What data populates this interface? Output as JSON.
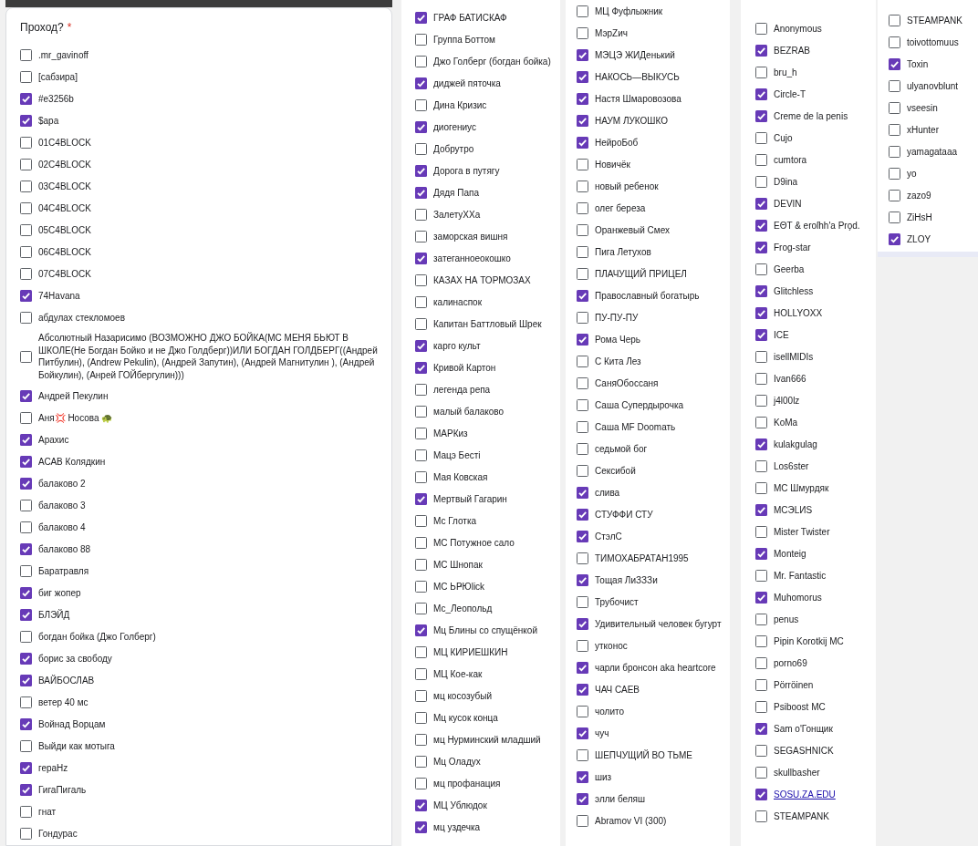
{
  "columns": [
    {
      "question": "Проход?",
      "required_mark": "*",
      "options": [
        {
          "label": ".mr_gavinoff",
          "checked": false
        },
        {
          "label": "[сабзира]",
          "checked": false
        },
        {
          "label": "#e3256b",
          "checked": true
        },
        {
          "label": "$apa",
          "checked": true
        },
        {
          "label": "01C4BLOCK",
          "checked": false
        },
        {
          "label": "02C4BLOCK",
          "checked": false
        },
        {
          "label": "03C4BLOCK",
          "checked": false
        },
        {
          "label": "04C4BLOCK",
          "checked": false
        },
        {
          "label": "05C4BLOCK",
          "checked": false
        },
        {
          "label": "06C4BLOCK",
          "checked": false
        },
        {
          "label": "07C4BLOCK",
          "checked": false
        },
        {
          "label": "74Havana",
          "checked": true
        },
        {
          "label": "абдулах стекломоев",
          "checked": false
        },
        {
          "label": "Абсолютный Назарисимо (ВОЗМОЖНО ДЖО БОЙКА(МС МЕНЯ БЬЮТ В ШКОЛЕ(Не Богдан Бойко и не Джо Голдберг))ИЛИ БОГДАН ГОЛДБЕРГ((Андрей Питбулин), (Andrew Pekulin), (Андрей Запутин), (Андрей Магнитулин ), (Андрей Бойкулин), (Анрей ГОЙбергулин)))",
          "checked": false
        },
        {
          "label": "Андрей Пекулин",
          "checked": true
        },
        {
          "label": "Аня💢 Носова 🐢",
          "checked": false
        },
        {
          "label": "Арахис",
          "checked": true
        },
        {
          "label": "АСАВ Колядкин",
          "checked": true
        },
        {
          "label": "балаково 2",
          "checked": true
        },
        {
          "label": "балаково 3",
          "checked": false
        },
        {
          "label": "балаково 4",
          "checked": false
        },
        {
          "label": "балаково 88",
          "checked": true
        },
        {
          "label": "Баратравля",
          "checked": false
        },
        {
          "label": "биг жопер",
          "checked": true
        },
        {
          "label": "БЛЭЙД",
          "checked": true
        },
        {
          "label": "богдан бойка (Джо Голберг)",
          "checked": false
        },
        {
          "label": "борис за свободу",
          "checked": true
        },
        {
          "label": "ВАЙБОСЛАВ",
          "checked": true
        },
        {
          "label": "ветер 40 мс",
          "checked": false
        },
        {
          "label": "Войнад Ворцам",
          "checked": true
        },
        {
          "label": "Выйди как мотыга",
          "checked": false
        },
        {
          "label": "гераHz",
          "checked": true
        },
        {
          "label": "ГигаПигаль",
          "checked": true
        },
        {
          "label": "гнат",
          "checked": false
        },
        {
          "label": "Гондурас",
          "checked": false
        }
      ]
    },
    {
      "options": [
        {
          "label": "ГРАФ БАТИСКАФ",
          "checked": true
        },
        {
          "label": "Группа Боттом",
          "checked": false
        },
        {
          "label": "Джо Голберг (богдан бойка)",
          "checked": false
        },
        {
          "label": "диджей пяточка",
          "checked": true
        },
        {
          "label": "Дина Кризис",
          "checked": false
        },
        {
          "label": "диогениус",
          "checked": true
        },
        {
          "label": "Добрутро",
          "checked": false
        },
        {
          "label": "Дорога в путягу",
          "checked": true
        },
        {
          "label": "Дядя Папа",
          "checked": true
        },
        {
          "label": "ЗалетуХХа",
          "checked": false
        },
        {
          "label": "заморская вишня",
          "checked": false
        },
        {
          "label": "затеганноеокошко",
          "checked": true
        },
        {
          "label": "КАЗАХ НА ТОРМОЗАХ",
          "checked": false
        },
        {
          "label": "калинаспок",
          "checked": false
        },
        {
          "label": "Капитан Баттловый Шрек",
          "checked": false
        },
        {
          "label": "карго культ",
          "checked": true
        },
        {
          "label": "Кривой Картон",
          "checked": true
        },
        {
          "label": "легенда репа",
          "checked": false
        },
        {
          "label": "малый балаково",
          "checked": false
        },
        {
          "label": "МАРКиз",
          "checked": false
        },
        {
          "label": "Мацэ Бесті",
          "checked": false
        },
        {
          "label": "Мая Ковская",
          "checked": false
        },
        {
          "label": "Мертвый Гагарин",
          "checked": true
        },
        {
          "label": "Мс Глотка",
          "checked": false
        },
        {
          "label": "МС Потужное сало",
          "checked": false
        },
        {
          "label": "МС Шнопак",
          "checked": false
        },
        {
          "label": "МС ЬҎЮlick",
          "checked": false
        },
        {
          "label": "Мс_Леопольд",
          "checked": false
        },
        {
          "label": "Мц Блины со спущёнкой",
          "checked": true
        },
        {
          "label": "МЦ КИРИЕШКИН",
          "checked": false
        },
        {
          "label": "МЦ Кое-как",
          "checked": false
        },
        {
          "label": "мц косозубый",
          "checked": false
        },
        {
          "label": "Мц кусок конца",
          "checked": false
        },
        {
          "label": "мц Нурминский младший",
          "checked": false
        },
        {
          "label": "Мц Оладух",
          "checked": false
        },
        {
          "label": "мц профанация",
          "checked": false
        },
        {
          "label": "МЦ Ублюдок",
          "checked": true
        },
        {
          "label": "мц уздечка",
          "checked": true
        }
      ]
    },
    {
      "options": [
        {
          "label": "МЦ Фуфлыжник",
          "checked": false
        },
        {
          "label": "МэрZич",
          "checked": false
        },
        {
          "label": "МЭЦЭ ЖИДенький",
          "checked": true
        },
        {
          "label": "НАКОСЬ—ВЫКУСЬ",
          "checked": true
        },
        {
          "label": "Настя Шмаровозова",
          "checked": true
        },
        {
          "label": "НАУМ ЛУКОШКО",
          "checked": true
        },
        {
          "label": "НейроБоб",
          "checked": true
        },
        {
          "label": "Новичёк",
          "checked": false
        },
        {
          "label": "новый ребенок",
          "checked": false
        },
        {
          "label": "олег береза",
          "checked": false
        },
        {
          "label": "Оранжевый Смех",
          "checked": false
        },
        {
          "label": "Пига Летухов",
          "checked": false
        },
        {
          "label": "ПЛАЧУЩИЙ ПРИЦЕЛ",
          "checked": false
        },
        {
          "label": "Православный богатырь",
          "checked": true
        },
        {
          "label": "ПУ-ПУ-ПУ",
          "checked": false
        },
        {
          "label": "Рома Черь",
          "checked": true
        },
        {
          "label": "С Кита Лез",
          "checked": false
        },
        {
          "label": "СаняОбоссаня",
          "checked": false
        },
        {
          "label": "Саша Супердырочка",
          "checked": false
        },
        {
          "label": "Саша MF Doomать",
          "checked": false
        },
        {
          "label": "седьмой бог",
          "checked": false
        },
        {
          "label": "Сексибой",
          "checked": false
        },
        {
          "label": "слива",
          "checked": true
        },
        {
          "label": "СТУФФИ СТУ",
          "checked": true
        },
        {
          "label": "СтэлС",
          "checked": true
        },
        {
          "label": "ТИМОХАБРАТАН1995",
          "checked": false
        },
        {
          "label": "Тощая ЛиЗЗЗи",
          "checked": true
        },
        {
          "label": "Трубочист",
          "checked": false
        },
        {
          "label": "Удивительный человек бугурт",
          "checked": true
        },
        {
          "label": "утконос",
          "checked": false
        },
        {
          "label": "чарли бронсон  aka heartcore",
          "checked": true
        },
        {
          "label": "ЧАЧ САЕВ",
          "checked": true
        },
        {
          "label": "чолито",
          "checked": false
        },
        {
          "label": "чуч",
          "checked": true
        },
        {
          "label": "ШЕПЧУЩИЙ ВО ТЬМЕ",
          "checked": false
        },
        {
          "label": "шиз",
          "checked": true
        },
        {
          "label": "элли беляш",
          "checked": true
        },
        {
          "label": "Abramov VI (300)",
          "checked": false
        }
      ]
    },
    {
      "options": [
        {
          "label": "Anonymous",
          "checked": false,
          "kind": "plain"
        },
        {
          "label": "BEZRAB",
          "checked": true,
          "kind": "plain"
        },
        {
          "label": "bru_h",
          "checked": false,
          "kind": "plain"
        },
        {
          "label": "Circle-T",
          "checked": true,
          "kind": "plain"
        },
        {
          "label": "Creme de la penis",
          "checked": true,
          "kind": "plain"
        },
        {
          "label": "Cujo",
          "checked": false,
          "kind": "plain"
        },
        {
          "label": "cumtora",
          "checked": false,
          "kind": "plain"
        },
        {
          "label": "D9ina",
          "checked": false,
          "kind": "plain"
        },
        {
          "label": "DEVIN",
          "checked": true,
          "kind": "plain"
        },
        {
          "label": "EΘT & eroſhh'a Pro̗d.",
          "checked": true,
          "kind": "plain"
        },
        {
          "label": "Frog-star",
          "checked": true,
          "kind": "plain"
        },
        {
          "label": "Geerba",
          "checked": false,
          "kind": "plain"
        },
        {
          "label": "Glitchless",
          "checked": true,
          "kind": "plain"
        },
        {
          "label": "HOLLYOXX",
          "checked": true,
          "kind": "plain"
        },
        {
          "label": "ICE",
          "checked": true,
          "kind": "plain"
        },
        {
          "label": "isellMIDIs",
          "checked": false,
          "kind": "plain"
        },
        {
          "label": "Ivan666",
          "checked": false,
          "kind": "plain"
        },
        {
          "label": "j4l00lz",
          "checked": false,
          "kind": "plain"
        },
        {
          "label": "KoMa",
          "checked": false,
          "kind": "plain"
        },
        {
          "label": "kulakgulag",
          "checked": true,
          "kind": "plain"
        },
        {
          "label": "Los6ster",
          "checked": false,
          "kind": "plain"
        },
        {
          "label": "MC Шмурдяк",
          "checked": false,
          "kind": "plain"
        },
        {
          "label": "MCЭLИS",
          "checked": true,
          "kind": "plain"
        },
        {
          "label": "Mister Twister",
          "checked": false,
          "kind": "plain"
        },
        {
          "label": "Monteig",
          "checked": true,
          "kind": "plain"
        },
        {
          "label": "Mr. Fantastic",
          "checked": false,
          "kind": "plain"
        },
        {
          "label": "Muhomorus",
          "checked": true,
          "kind": "plain"
        },
        {
          "label": "penus",
          "checked": false,
          "kind": "plain"
        },
        {
          "label": "Pipin Korotkij MC",
          "checked": false,
          "kind": "plain"
        },
        {
          "label": "porno69",
          "checked": false,
          "kind": "plain"
        },
        {
          "label": "Pörröinen",
          "checked": false,
          "kind": "plain"
        },
        {
          "label": "Psiboost MC",
          "checked": false,
          "kind": "plain"
        },
        {
          "label": "Sam o'Гонщик",
          "checked": true,
          "kind": "plain"
        },
        {
          "label": "SEGASHNICK",
          "checked": false,
          "kind": "plain"
        },
        {
          "label": "skullbasher",
          "checked": false,
          "kind": "plain"
        },
        {
          "label": "SOSU.ZA.EDU",
          "checked": true,
          "kind": "link"
        },
        {
          "label": "STEAMPANK",
          "checked": false,
          "kind": "plain"
        }
      ]
    },
    {
      "options": [
        {
          "label": "STEAMPANK",
          "checked": false
        },
        {
          "label": "toivottomuus",
          "checked": false
        },
        {
          "label": "Toxin",
          "checked": true
        },
        {
          "label": "ulyanovblunt",
          "checked": false
        },
        {
          "label": "vseesin",
          "checked": false
        },
        {
          "label": "xHunter",
          "checked": false
        },
        {
          "label": "yamagataaa",
          "checked": false
        },
        {
          "label": "yo",
          "checked": false
        },
        {
          "label": "zazo9",
          "checked": false
        },
        {
          "label": "ZiHsH",
          "checked": false
        },
        {
          "label": "ZLOY",
          "checked": true
        }
      ]
    }
  ]
}
